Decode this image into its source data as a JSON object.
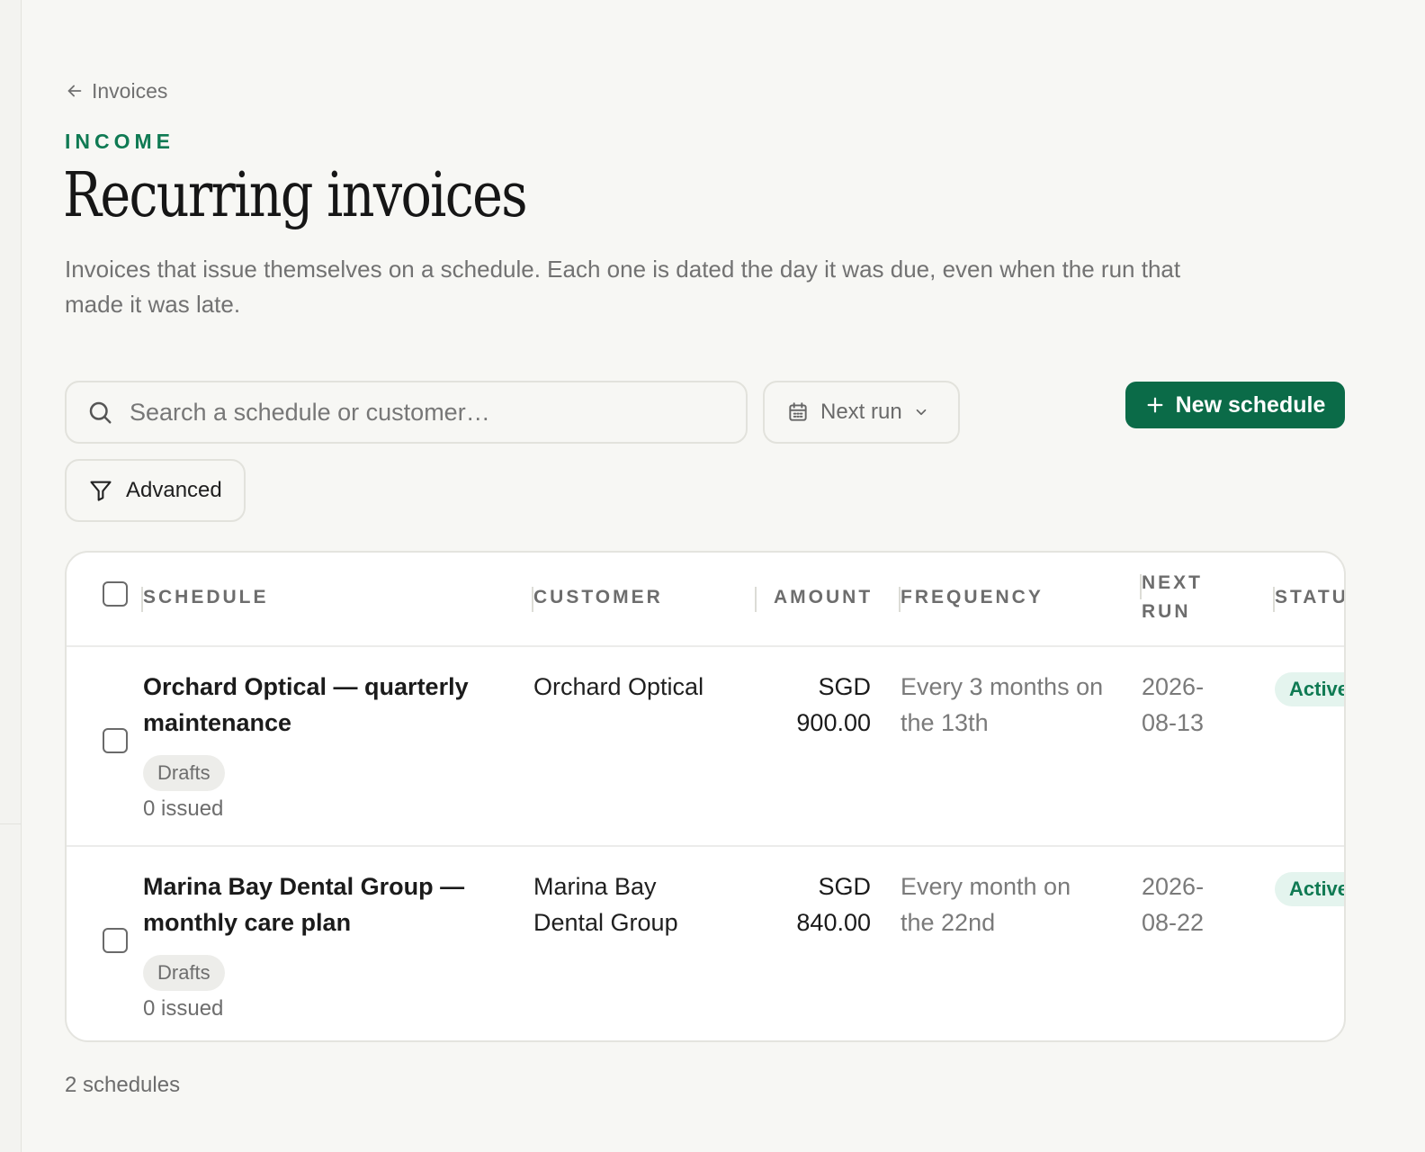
{
  "nav": {
    "back_label": "Invoices"
  },
  "header": {
    "eyebrow": "INCOME",
    "title": "Recurring invoices",
    "description": "Invoices that issue themselves on a schedule. Each one is dated the day it was due, even when the run that made it was late."
  },
  "toolbar": {
    "search_placeholder": "Search a schedule or customer…",
    "sort_label": "Next run",
    "new_button_label": "New schedule",
    "advanced_label": "Advanced"
  },
  "table": {
    "columns": {
      "schedule": "SCHEDULE",
      "customer": "CUSTOMER",
      "amount": "AMOUNT",
      "frequency": "FREQUENCY",
      "next_run_1": "NEXT",
      "next_run_2": "RUN",
      "status": "STATUS"
    },
    "rows": [
      {
        "schedule": "Orchard Optical — quarterly maintenance",
        "mode": "Drafts",
        "issued": "0 issued",
        "customer": "Orchard Optical",
        "amount_currency": "SGD",
        "amount_value": "900.00",
        "frequency": "Every 3 months on the 13th",
        "next_run_1": "2026-",
        "next_run_2": "08-13",
        "status": "Active"
      },
      {
        "schedule": "Marina Bay Dental Group — monthly care plan",
        "mode": "Drafts",
        "issued": "0 issued",
        "customer": "Marina Bay Dental Group",
        "amount_currency": "SGD",
        "amount_value": "840.00",
        "frequency": "Every month on the 22nd",
        "next_run_1": "2026-",
        "next_run_2": "08-22",
        "status": "Active"
      }
    ]
  },
  "footer": {
    "count": "2 schedules"
  },
  "colors": {
    "accent": "#0b6b48",
    "eyebrow": "#0f7a53",
    "status_bg": "#e4f4ee"
  },
  "icons": {
    "back": "arrow-left-icon",
    "search": "search-icon",
    "sort": "calendar-icon",
    "sort_caret": "chevron-down-icon",
    "new": "plus-icon",
    "advanced": "filter-icon"
  }
}
